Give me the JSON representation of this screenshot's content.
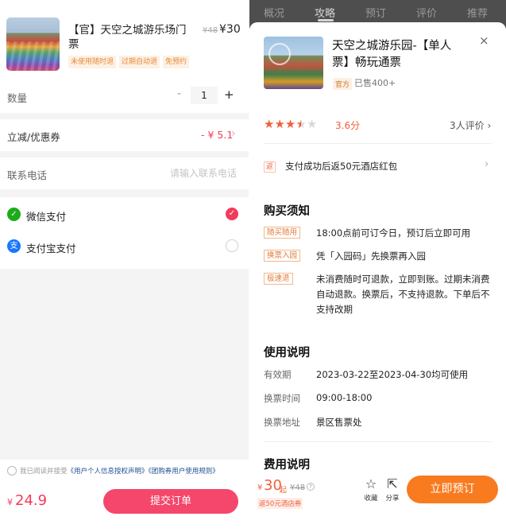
{
  "order": {
    "product": {
      "title": "【官】天空之城游乐场门票",
      "original_price": "¥48",
      "price": "¥30",
      "tags": [
        "未使用随时退",
        "过期自动退",
        "免预约"
      ]
    },
    "quantity": {
      "label": "数量",
      "minus": "-",
      "value": "1",
      "plus": "+"
    },
    "discount": {
      "label": "立减/优惠券",
      "value": "- ¥ 5.1",
      "chevron": "›"
    },
    "phone": {
      "label": "联系电话",
      "placeholder": "请输入联系电话"
    },
    "payment": [
      {
        "label": "微信支付",
        "icon": "wechat-pay-icon",
        "glyph": "✓",
        "selected": true,
        "color": "#1aad19"
      },
      {
        "label": "支付宝支付",
        "icon": "alipay-icon",
        "glyph": "支",
        "selected": false,
        "color": "#1677ff"
      }
    ],
    "agreement": {
      "prefix": "我已阅读并接受",
      "link1": "《用户个人信息授权声明》",
      "link2": "《团购券用户使用规则》"
    },
    "total": {
      "currency": "¥",
      "amount": "24.9"
    },
    "submit_label": "提交订单"
  },
  "detail": {
    "tabs": [
      "概况",
      "攻略",
      "预订",
      "评价",
      "推荐"
    ],
    "active_tab": "攻略",
    "close_label": "×",
    "title": "天空之城游乐园-【单人票】畅玩通票",
    "official_badge": "官方",
    "sold": "已售400+",
    "rating": {
      "stars": 3.5,
      "max": 5,
      "score_label": "3.6分",
      "reviews_label": "3人评价 ›"
    },
    "rebate": {
      "icon_label": "返",
      "text": "支付成功后返50元酒店红包",
      "chevron": "›"
    },
    "notice": {
      "title": "购买须知",
      "items": [
        {
          "tag": "随买随用",
          "text": "18:00点前可订今日，预订后立即可用"
        },
        {
          "tag": "换票入园",
          "text": "凭「入园码」先换票再入园"
        },
        {
          "tag": "极速退",
          "text": "未消费随时可退款，立即到账。过期未消费自动退款。换票后，不支持退款。下单后不支持改期"
        }
      ]
    },
    "usage": {
      "title": "使用说明",
      "rows": [
        {
          "label": "有效期",
          "value": "2023-03-22至2023-04-30均可使用"
        },
        {
          "label": "换票时间",
          "value": "09:00-18:00"
        },
        {
          "label": "换票地址",
          "value": "景区售票处"
        }
      ]
    },
    "fee_title": "费用说明",
    "bottom": {
      "currency": "¥",
      "price": "30",
      "from_label": "起",
      "original_price": "¥48",
      "info_glyph": "?",
      "hotel_label": "返50元酒店券",
      "favorite_label": "收藏",
      "share_label": "分享",
      "book_label": "立即预订"
    }
  },
  "colors": {
    "accent_red": "#f23b5a",
    "accent_orange": "#f97b1f",
    "tag_orange": "#e07b3a"
  }
}
